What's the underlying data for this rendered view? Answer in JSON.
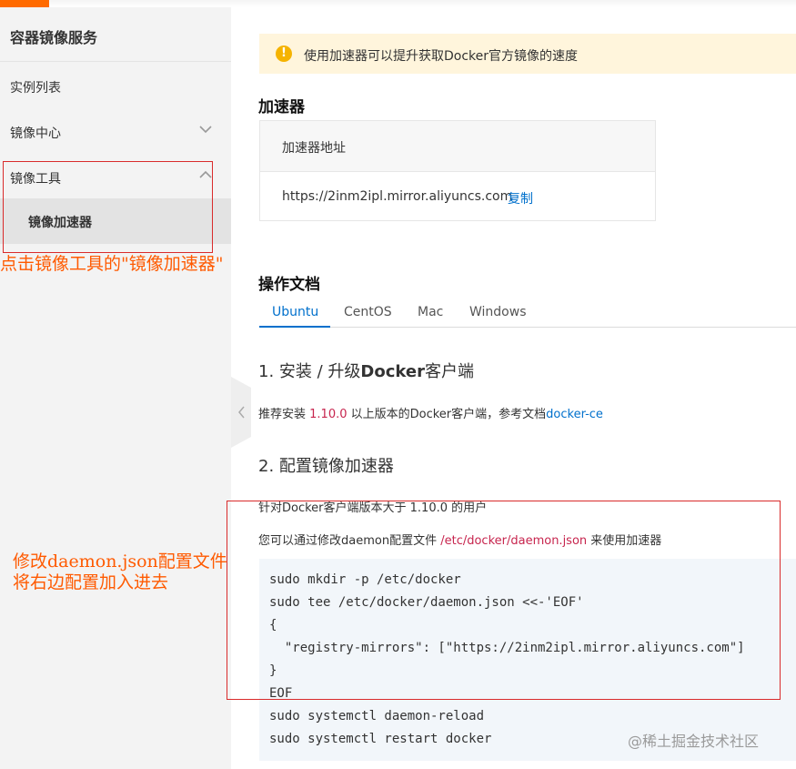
{
  "sidebar": {
    "title": "容器镜像服务",
    "items": [
      {
        "label": "实例列表"
      },
      {
        "label": "镜像中心",
        "icon": "chevron-down-icon"
      },
      {
        "label": "镜像工具",
        "icon": "chevron-up-icon"
      }
    ],
    "sub_item": {
      "label": "镜像加速器"
    }
  },
  "annotations": {
    "click_hint": "点击镜像工具的\"镜像加速器\"",
    "edit_hint_line1": "修改daemon.json配置文件",
    "edit_hint_line2": "将右边配置加入进去",
    "color": "#ff5a00",
    "box_color": "#d92b2b"
  },
  "notice": {
    "icon": "exclamation-icon",
    "text": "使用加速器可以提升获取Docker官方镜像的速度"
  },
  "accelerator": {
    "title": "加速器",
    "column_header": "加速器地址",
    "url": "https://2inm2ipl.mirror.aliyuncs.com",
    "copy_label": "复制"
  },
  "docs": {
    "title": "操作文档",
    "tabs": [
      "Ubuntu",
      "CentOS",
      "Mac",
      "Windows"
    ],
    "active_tab": "Ubuntu",
    "step1": {
      "num": "1. ",
      "pre": "安装 / 升级",
      "bold": "Docker",
      "post": "客户端"
    },
    "step1_text": {
      "pre": "推荐安装 ",
      "version": "1.10.0",
      "mid": " 以上版本的Docker客户端，参考文档",
      "link": "docker-ce"
    },
    "step2": {
      "title": "2. 配置镜像加速器"
    },
    "step2_text1": "针对Docker客户端版本大于 1.10.0 的用户",
    "step2_text2": {
      "pre": "您可以通过修改daemon配置文件 ",
      "path": "/etc/docker/daemon.json",
      "post": " 来使用加速器"
    },
    "code_lines": [
      "sudo mkdir -p /etc/docker",
      "sudo tee /etc/docker/daemon.json <<-'EOF'",
      "{",
      "  \"registry-mirrors\": [\"https://2inm2ipl.mirror.aliyuncs.com\"]",
      "}",
      "EOF",
      "sudo systemctl daemon-reload",
      "sudo systemctl restart docker"
    ]
  },
  "watermark": "@稀土掘金技术社区",
  "colors": {
    "brand": "#ff6a00",
    "link": "#0070cc",
    "highlight": "#c7254e",
    "notice_bg": "#fff5dc"
  }
}
